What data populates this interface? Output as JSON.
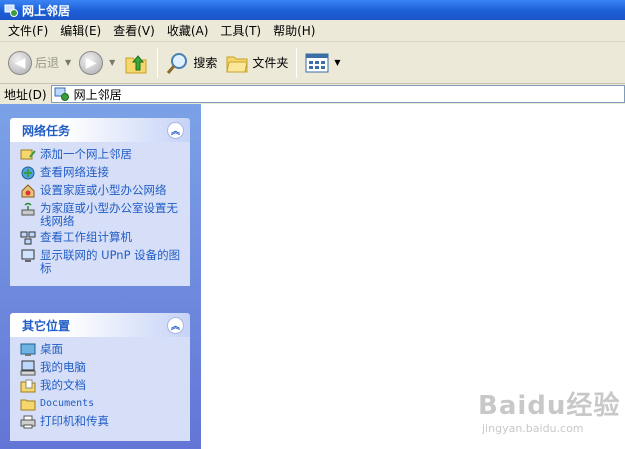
{
  "window": {
    "title": "网上邻居"
  },
  "menu": [
    "文件(F)",
    "编辑(E)",
    "查看(V)",
    "收藏(A)",
    "工具(T)",
    "帮助(H)"
  ],
  "toolbar": {
    "back_label": "后退",
    "search_label": "搜索",
    "folders_label": "文件夹"
  },
  "address": {
    "label": "地址(D)",
    "value": "网上邻居"
  },
  "network_tasks": {
    "title": "网络任务",
    "items": [
      {
        "label": "添加一个网上邻居",
        "icon": "add-network-place-icon"
      },
      {
        "label": "查看网络连接",
        "icon": "network-connections-icon"
      },
      {
        "label": "设置家庭或小型办公网络",
        "icon": "home-network-setup-icon"
      },
      {
        "label": "为家庭或小型办公室设置无线网络",
        "icon": "wireless-network-icon"
      },
      {
        "label": "查看工作组计算机",
        "icon": "workgroup-computers-icon"
      },
      {
        "label": "显示联网的 UPnP 设备的图标",
        "icon": "upnp-devices-icon"
      }
    ]
  },
  "other_places": {
    "title": "其它位置",
    "items": [
      {
        "label": "桌面",
        "icon": "desktop-icon"
      },
      {
        "label": "我的电脑",
        "icon": "my-computer-icon"
      },
      {
        "label": "我的文档",
        "icon": "my-documents-icon"
      },
      {
        "label": "Documents",
        "icon": "folder-icon"
      },
      {
        "label": "打印机和传真",
        "icon": "printer-icon"
      }
    ]
  },
  "watermark": {
    "logo": "Baidu经验",
    "url": "jingyan.baidu.com"
  }
}
